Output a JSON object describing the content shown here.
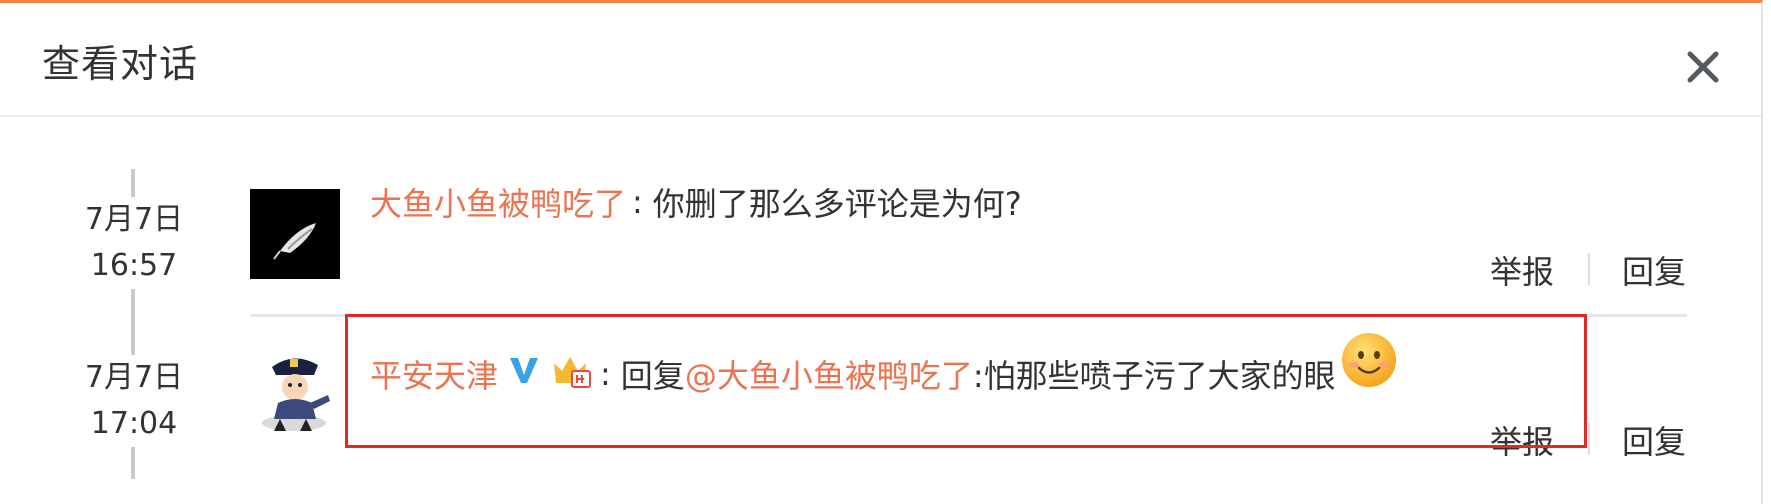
{
  "dialog": {
    "title": "查看对话",
    "close_icon": "close-icon",
    "accent_color": "#f0834a"
  },
  "messages": [
    {
      "date": "7月7日",
      "time": "16:57",
      "username": "大鱼小鱼被鸭吃了",
      "colon": ":",
      "text": "你删了那么多评论是为何?",
      "report_label": "举报",
      "reply_label": "回复",
      "avatar_icon": "feather-avatar-icon"
    },
    {
      "date": "7月7日",
      "time": "17:04",
      "username": "平安天津",
      "colon": ":",
      "reply_prefix": "回复",
      "mention": "@大鱼小鱼被鸭吃了",
      "text": ":怕那些喷子污了大家的眼",
      "report_label": "举报",
      "reply_label": "回复",
      "avatar_icon": "police-cartoon-avatar-icon",
      "verified_icon": "blue-v-verified-icon",
      "member_icon": "crown-member-badge-icon",
      "emoji_icon": "smile-emoji-icon"
    }
  ],
  "colors": {
    "username": "#eb7350",
    "text": "#333333",
    "highlight_border": "#e02a24"
  }
}
